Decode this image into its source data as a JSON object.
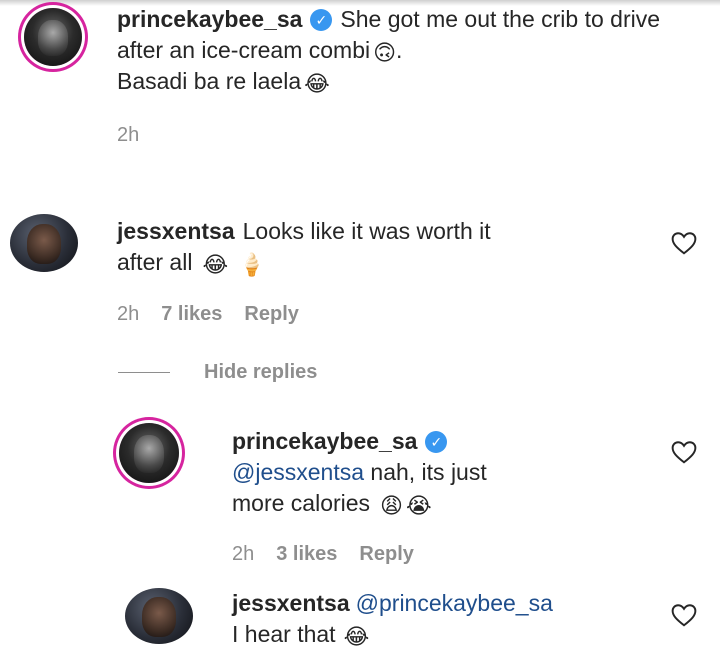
{
  "comments": [
    {
      "username": "princekaybee_sa",
      "verified": true,
      "text": "She got me out the crib to drive after an ice-cream combi",
      "text_after_emoji": ".",
      "emoji1": "🙃",
      "line2": "Basadi ba re laela",
      "emoji2": "😂",
      "time": "2h"
    },
    {
      "username": "jessxentsa",
      "text": "Looks like it was worth it",
      "line2": "after all",
      "emoji1": "😂",
      "emoji2": "🍦",
      "time": "2h",
      "likes": "7 likes",
      "reply": "Reply"
    }
  ],
  "hide_replies_label": "Hide replies",
  "replies": [
    {
      "username": "princekaybee_sa",
      "verified": true,
      "mention": "@jessxentsa",
      "text": "nah, its just",
      "line2": "more calories",
      "emoji1": "😩",
      "emoji2": "😭",
      "time": "2h",
      "likes": "3 likes",
      "reply": "Reply"
    },
    {
      "username": "jessxentsa",
      "mention": "@princekaybee_sa",
      "line2": "I hear that",
      "emoji1": "😂"
    }
  ],
  "icons": {
    "verified": "verified-badge-icon",
    "heart": "heart-outline-icon"
  }
}
